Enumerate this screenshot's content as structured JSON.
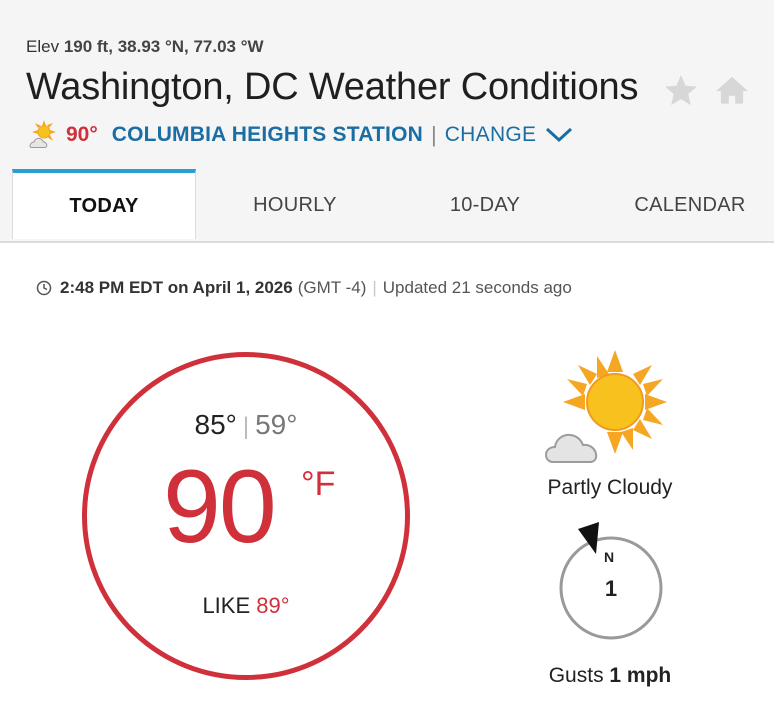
{
  "location": {
    "elev_label": "Elev",
    "elev_value": "190 ft,",
    "coords": "38.93 °N, 77.03 °W",
    "title": "Washington, DC Weather Conditions"
  },
  "station": {
    "current_temp": "90°",
    "name": "COLUMBIA HEIGHTS STATION",
    "separator": "|",
    "change_label": "CHANGE"
  },
  "tabs": [
    {
      "label": "TODAY",
      "active": true
    },
    {
      "label": "HOURLY",
      "active": false
    },
    {
      "label": "10-DAY",
      "active": false
    },
    {
      "label": "CALENDAR",
      "active": false
    }
  ],
  "timestamp": {
    "time_date": "2:48 PM EDT on April 1, 2026",
    "timezone": "(GMT -4)",
    "separator": "|",
    "updated": "Updated 21 seconds ago"
  },
  "current": {
    "high": "85°",
    "separator": "|",
    "low": "59°",
    "temp": "90",
    "unit": "°F",
    "feels_like_label": "LIKE",
    "feels_like_value": "89°",
    "condition": "Partly Cloudy",
    "condition_icon": "partly-cloudy-icon"
  },
  "wind": {
    "direction": "N",
    "speed": "1",
    "gusts_label": "Gusts",
    "gusts_value": "1 mph"
  },
  "colors": {
    "accent_red": "#d0303a",
    "link_blue": "#1a6ea3",
    "tab_active": "#2a9fd6"
  }
}
